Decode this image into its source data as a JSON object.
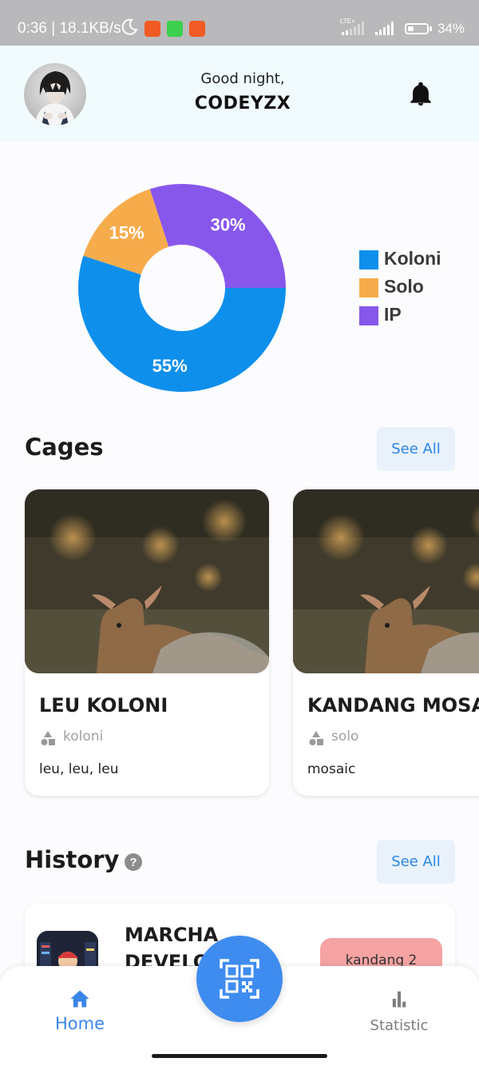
{
  "status_bar": {
    "time_speed": "0:36 | 18.1KB/s",
    "lte_label": "LTE+",
    "battery_text": "34%",
    "battery_level": 0.34
  },
  "header": {
    "greeting": "Good night,",
    "username": "CODEYZX"
  },
  "chart_data": {
    "type": "pie",
    "variant": "donut",
    "categories": [
      "Koloni",
      "Solo",
      "IP"
    ],
    "values": [
      55,
      15,
      30
    ],
    "value_labels": [
      "55%",
      "15%",
      "30%"
    ],
    "colors": [
      "#0e8fec",
      "#f7ac4c",
      "#8757eb"
    ],
    "legend_position": "right"
  },
  "cages": {
    "title": "Cages",
    "see_all": "See All",
    "items": [
      {
        "name": "LEU KOLONI",
        "type": "koloni",
        "description": "leu, leu, leu"
      },
      {
        "name": "KANDANG MOSAIC",
        "type": "solo",
        "description": "mosaic"
      }
    ]
  },
  "history": {
    "title": "History",
    "help": "?",
    "see_all": "See All",
    "items": [
      {
        "name": "MARCHA DEVELOPER",
        "badge": "kandang 2"
      }
    ]
  },
  "nav": {
    "home": "Home",
    "statistic": "Statistic"
  },
  "colors": {
    "accent": "#3f8cf0",
    "see_all_bg": "#e9f2fb",
    "header_bg": "#f1fbfd",
    "badge_bg": "#f6a3a3"
  },
  "icons": {
    "notification": "bell-icon",
    "scan": "qr-scan-icon",
    "home": "home-icon",
    "statistic": "bar-chart-icon",
    "cage_type": "shapes-icon",
    "help": "help-icon"
  }
}
